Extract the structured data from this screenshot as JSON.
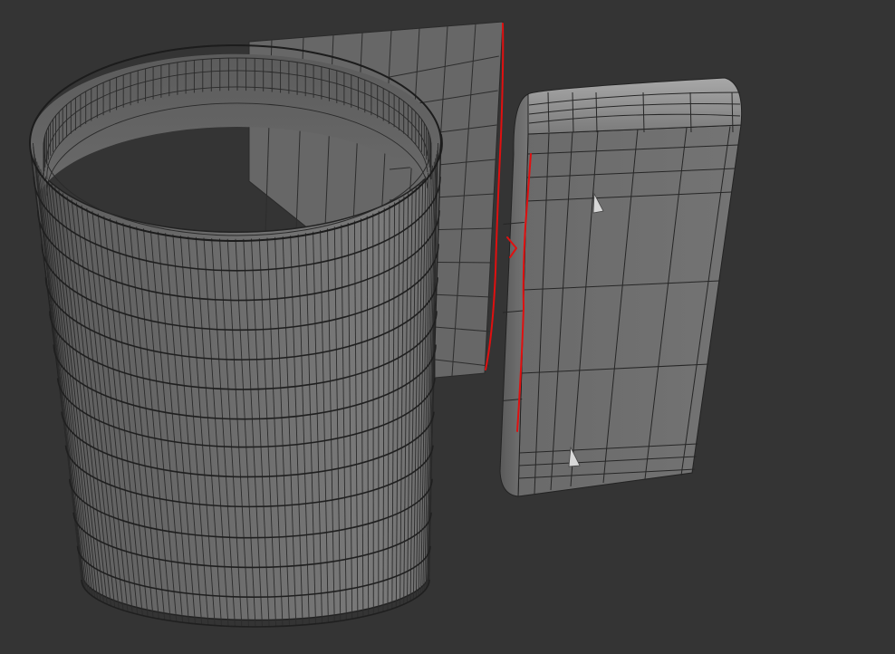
{
  "viewport": {
    "background": "#343434",
    "objects": [
      {
        "name": "cylinder-mesh",
        "surface": "#6b6b6b",
        "inner_surface": "#5d5d5d",
        "wire": "#262626"
      },
      {
        "name": "plane-mesh",
        "surface": "#676767",
        "wire": "#2a2a2a"
      },
      {
        "name": "slab-mesh",
        "surface": "#707070",
        "top_surface": "#9a9a9a",
        "wire": "#262626"
      }
    ],
    "annotations": {
      "stroke_color": "#e01010",
      "items": [
        "plane-edge-line",
        "arrow-mark",
        "slab-edge-line"
      ]
    }
  }
}
